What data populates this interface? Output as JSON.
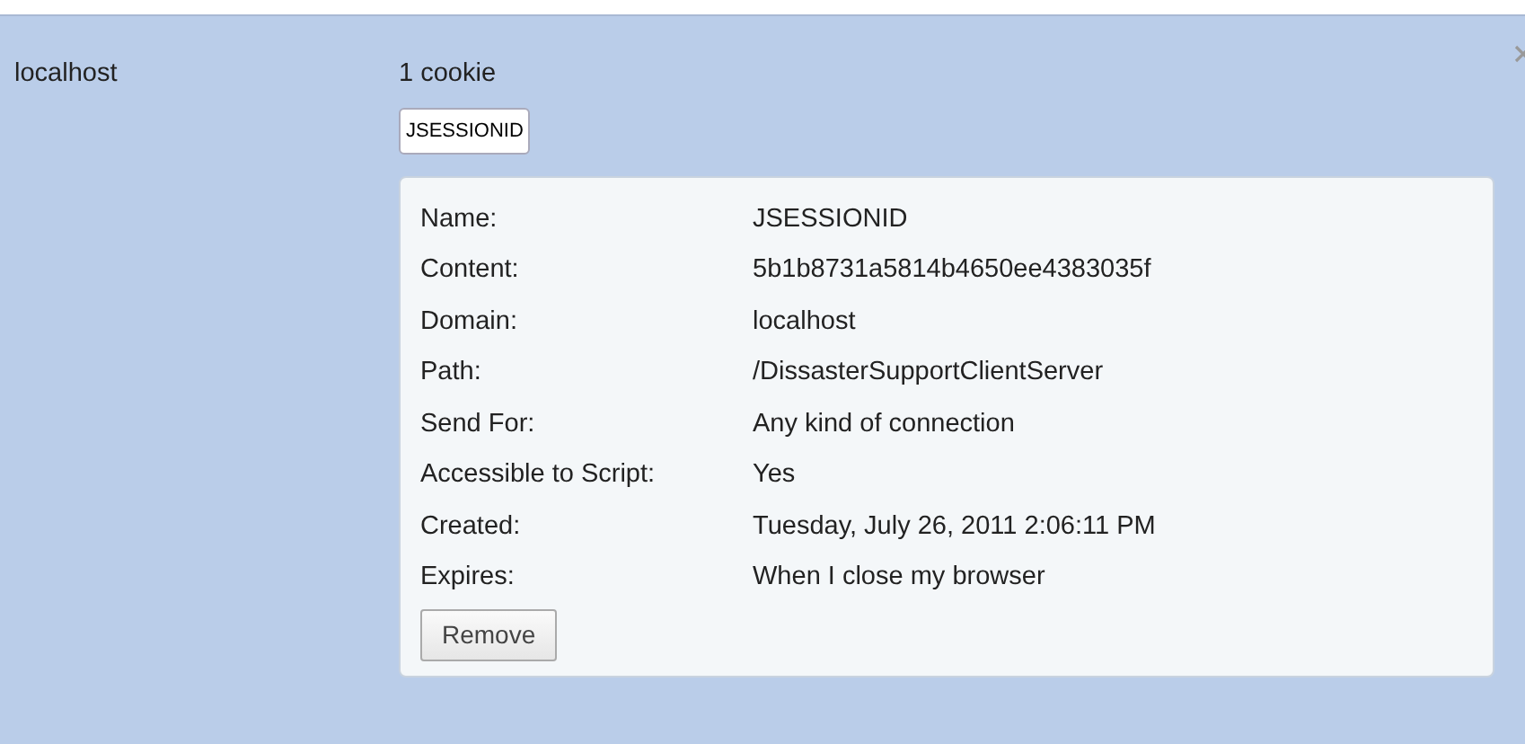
{
  "site": "localhost",
  "count": "1 cookie",
  "cookies": [
    {
      "label": "JSESSIONID",
      "selected": true
    }
  ],
  "details": [
    {
      "label": "Name:",
      "value": "JSESSIONID"
    },
    {
      "label": "Content:",
      "value": "5b1b8731a5814b4650ee4383035f"
    },
    {
      "label": "Domain:",
      "value": "localhost"
    },
    {
      "label": "Path:",
      "value": "/DissasterSupportClientServer"
    },
    {
      "label": "Send For:",
      "value": "Any kind of connection"
    },
    {
      "label": "Accessible to Script:",
      "value": "Yes"
    },
    {
      "label": "Created:",
      "value": "Tuesday, July 26, 2011 2:06:11 PM"
    },
    {
      "label": "Expires:",
      "value": "When I close my browser"
    }
  ],
  "remove_button": "Remove"
}
